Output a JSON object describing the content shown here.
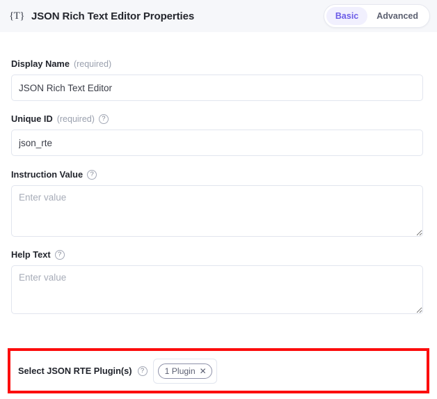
{
  "header": {
    "icon": "json-text-field-icon",
    "icon_glyph": "{T}",
    "title": "JSON Rich Text Editor Properties",
    "tabs": [
      {
        "label": "Basic",
        "active": true
      },
      {
        "label": "Advanced",
        "active": false
      }
    ],
    "accent_color": "#6c5ce7",
    "active_tab_bg": "#f1f0fe",
    "background": "#f6f7fa"
  },
  "fields": {
    "display_name": {
      "label": "Display Name",
      "required_text": "(required)",
      "value": "JSON Rich Text Editor",
      "placeholder": ""
    },
    "unique_id": {
      "label": "Unique ID",
      "required_text": "(required)",
      "help_icon": "help-circle-icon",
      "value": "json_rte",
      "placeholder": ""
    },
    "instruction_value": {
      "label": "Instruction Value",
      "help_icon": "help-circle-icon",
      "value": "",
      "placeholder": "Enter value"
    },
    "help_text": {
      "label": "Help Text",
      "help_icon": "help-circle-icon",
      "value": "",
      "placeholder": "Enter value"
    },
    "plugins": {
      "label": "Select JSON RTE Plugin(s)",
      "help_icon": "help-circle-icon",
      "chip_label": "1 Plugin",
      "chip_close_icon": "close-icon",
      "chip_close_glyph": "✕"
    }
  },
  "highlight": {
    "color": "#fc0d0d"
  }
}
